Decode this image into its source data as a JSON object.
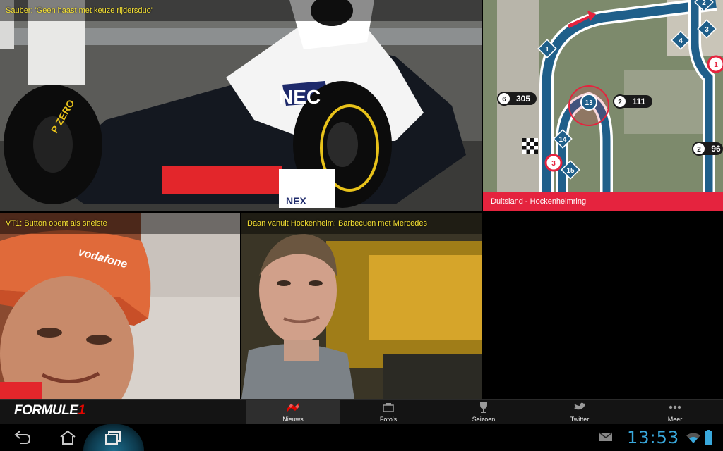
{
  "tiles": {
    "main": {
      "title": "Sauber: 'Geen haast met keuze rijdersduo'"
    },
    "map": {
      "title": "Duitsland - Hockenheimring"
    },
    "button": {
      "title": "VT1: Button opent als snelste"
    },
    "schumacher": {
      "title": "Daan vanuit Hockenheim: Barbecuen met Mercedes"
    }
  },
  "map_labels": {
    "corner_1": "1",
    "corner_2": "2",
    "corner_3": "3",
    "corner_4": "4",
    "corner_14": "14",
    "corner_15": "15",
    "marker_1": "1",
    "marker_3": "3",
    "marker_13": "13",
    "speed_a_gear": "6",
    "speed_a_value": "305",
    "speed_b_gear": "2",
    "speed_b_value": "111",
    "speed_c_gear": "2",
    "speed_c_value": "96"
  },
  "photo_texts": {
    "car_sponsor": "NEC",
    "car_tyre": "P ZERO",
    "car_nose": "NEX",
    "cap_brand": "vodafone"
  },
  "brand": {
    "name": "FORMULE",
    "number": "1"
  },
  "tabs": [
    {
      "label": "Nieuws",
      "icon": "checkered-flag-icon",
      "active": true
    },
    {
      "label": "Foto's",
      "icon": "photo-icon",
      "active": false
    },
    {
      "label": "Seizoen",
      "icon": "trophy-icon",
      "active": false
    },
    {
      "label": "Twitter",
      "icon": "bird-icon",
      "active": false
    },
    {
      "label": "Meer",
      "icon": "more-dots-icon",
      "active": false
    }
  ],
  "system": {
    "clock": "13:53"
  },
  "colors": {
    "caption": "#f7e233",
    "accent_red": "#e5233e",
    "clock_blue": "#39a8dc",
    "track_blue": "#1f5f8a"
  }
}
